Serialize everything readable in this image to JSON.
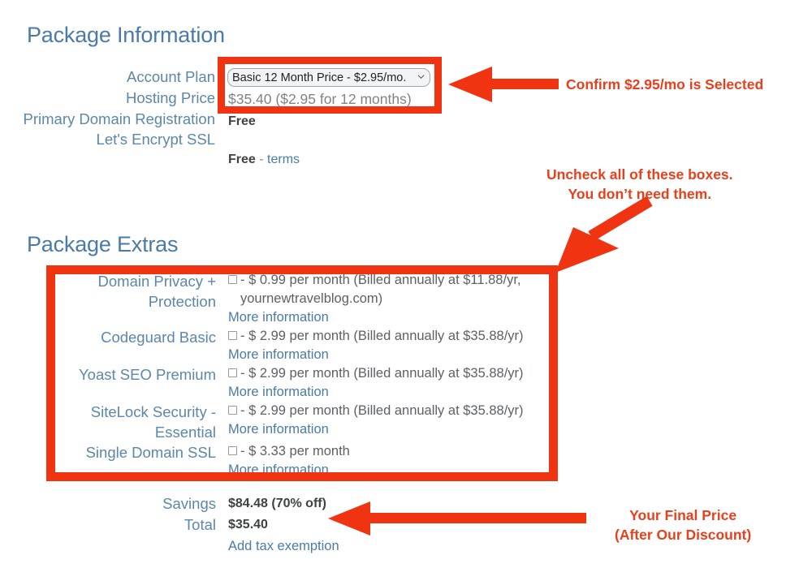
{
  "sections": {
    "package_information": {
      "heading": "Package Information",
      "labels": [
        "Account Plan",
        "Hosting Price",
        "Primary Domain\nRegistration",
        "Let's Encrypt SSL"
      ],
      "account_plan": {
        "selected": "Basic 12 Month Price - $2.95/mo.",
        "options": [
          "Basic 12 Month Price - $2.95/mo."
        ],
        "chevron_icon": "chevron-down-icon"
      },
      "hosting_price": "$35.40  ($2.95 for 12 months)",
      "primary_domain_registration": "Free",
      "lets_encrypt_ssl": {
        "value": "Free",
        "separator": " - ",
        "link": "terms"
      }
    },
    "package_extras": {
      "heading": "Package Extras",
      "items": [
        {
          "label": "Domain Privacy +\nProtection",
          "checked": false,
          "price_text": "- $ 0.99 per month (Billed annually at $11.88/yr, yournewtravelblog.com)",
          "more_info": "More information"
        },
        {
          "label": "Codeguard Basic",
          "checked": false,
          "price_text": "- $ 2.99 per month (Billed annually at $35.88/yr)",
          "more_info": "More information"
        },
        {
          "label": "Yoast SEO Premium",
          "checked": false,
          "price_text": "- $ 2.99 per month (Billed annually at $35.88/yr)",
          "more_info": "More information"
        },
        {
          "label": "SiteLock Security -\nEssential",
          "checked": false,
          "price_text": "- $ 2.99 per month (Billed annually at $35.88/yr)",
          "more_info": "More information"
        },
        {
          "label": "Single Domain SSL",
          "checked": false,
          "price_text": "- $ 3.33 per month",
          "more_info": "More information"
        }
      ]
    },
    "totals": {
      "savings_label": "Savings",
      "savings_value": "$84.48 (70% off)",
      "total_label": "Total",
      "total_value": "$35.40",
      "tax_link": "Add tax exemption"
    }
  },
  "annotations": {
    "color": "#e8401c",
    "arrow_color": "#f03311",
    "confirm_plan": "Confirm $2.95/mo is Selected",
    "uncheck_line1": "Uncheck all of these boxes.",
    "uncheck_line2": "You don’t need them.",
    "final_price_line1": "Your Final Price",
    "final_price_line2": "(After Our Discount)"
  }
}
